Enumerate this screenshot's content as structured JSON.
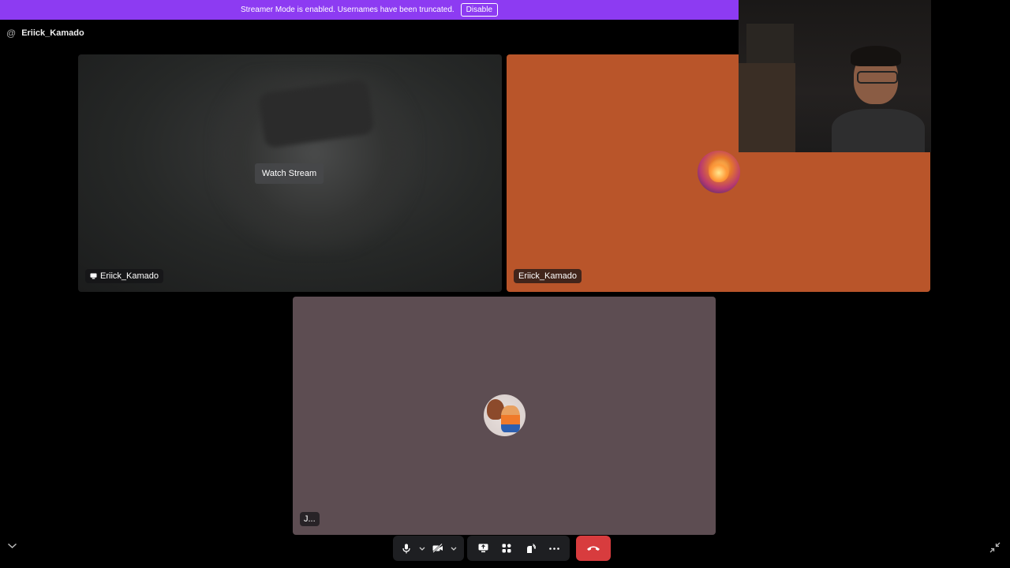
{
  "banner": {
    "message": "Streamer Mode is enabled. Usernames have been truncated.",
    "disable_label": "Disable",
    "color": "#8d3bf2"
  },
  "header": {
    "channel_name": "Eriick_Kamado"
  },
  "tiles": {
    "stream": {
      "watch_label": "Watch Stream",
      "username": "Eriick_Kamado"
    },
    "user_orange": {
      "username": "Eriick_Kamado",
      "background": "#b9552a"
    },
    "user_mauve": {
      "username": "J...",
      "background": "#5d4d52"
    }
  },
  "controls": {
    "icons": [
      "microphone-icon",
      "chevron-down-icon",
      "camera-off-icon",
      "chevron-down-icon",
      "screen-share-icon",
      "activities-icon",
      "soundboard-icon",
      "more-icon",
      "hang-up-icon"
    ],
    "hangup_color": "#d83c3e"
  }
}
